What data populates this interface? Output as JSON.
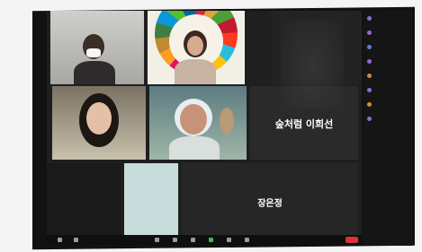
{
  "tiles": {
    "tile_1_name": "",
    "tile_2_name": "",
    "tile_3_name": "",
    "tile_4_name": "",
    "tile_5_name": "숲처럼 이희선",
    "tile_6_name": "",
    "tile_7_name": "장은정"
  },
  "colors": {
    "end_button": "#d9303a",
    "screen": "#1f1f1f"
  }
}
